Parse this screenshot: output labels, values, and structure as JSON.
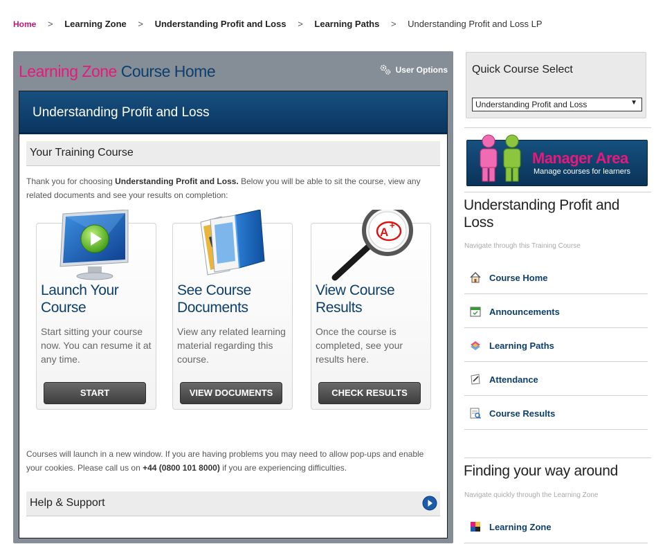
{
  "breadcrumb": {
    "home": "Home",
    "sep": ">",
    "items": [
      "Learning Zone",
      "Understanding Profit and Loss",
      "Learning Paths"
    ],
    "current": "Understanding Profit and Loss LP"
  },
  "header": {
    "title_part1": "Learning Zone",
    "title_part2": "Course Home",
    "user_options": "User Options"
  },
  "course": {
    "banner_title": "Understanding Profit and Loss",
    "section_title": "Your Training Course",
    "intro_pre": "Thank you for choosing ",
    "intro_bold": "Understanding Profit and Loss.",
    "intro_post": " Below you will be able to sit the course, view any related documents and see your results on completion:",
    "cards": [
      {
        "title": "Launch Your Course",
        "desc": "Start sitting your course now. You can resume it at any time.",
        "button": "START"
      },
      {
        "title": "See Course Documents",
        "desc": "View any related learning material regarding this course.",
        "button": "VIEW DOCUMENTS"
      },
      {
        "title": "View Course Results",
        "desc": "Once the course is completed, see your results here.",
        "button": "CHECK RESULTS"
      }
    ],
    "note_pre": "Courses will launch in a new window. If you are having problems you may need to allow pop-ups and enable your cookies. Please call us on ",
    "note_phone": "+44 (0800 101 8000)",
    "note_post": " if you are experiencing difficulties.",
    "help_title": "Help & Support"
  },
  "quick_select": {
    "title": "Quick Course Select",
    "selected": "Understanding Profit and Loss"
  },
  "manager_area": {
    "title": "Manager Area",
    "subtitle": "Manage courses for learners"
  },
  "course_nav": {
    "title": "Understanding Profit and Loss",
    "subtitle": "Navigate through this Training Course",
    "items": [
      {
        "label": "Course Home",
        "icon": "house-icon"
      },
      {
        "label": "Announcements",
        "icon": "calendar-icon"
      },
      {
        "label": "Learning Paths",
        "icon": "paths-icon"
      },
      {
        "label": "Attendance",
        "icon": "pen-icon"
      },
      {
        "label": "Course Results",
        "icon": "results-icon"
      }
    ]
  },
  "find_way": {
    "title": "Finding your way around",
    "subtitle": "Navigate quickly through the Learning Zone",
    "items": [
      {
        "label": "Learning Zone",
        "icon": "learning-zone-icon"
      }
    ]
  },
  "colors": {
    "brand_pink": "#e8187c",
    "brand_blue": "#0c3f6e",
    "panel_grey": "#858d96"
  }
}
